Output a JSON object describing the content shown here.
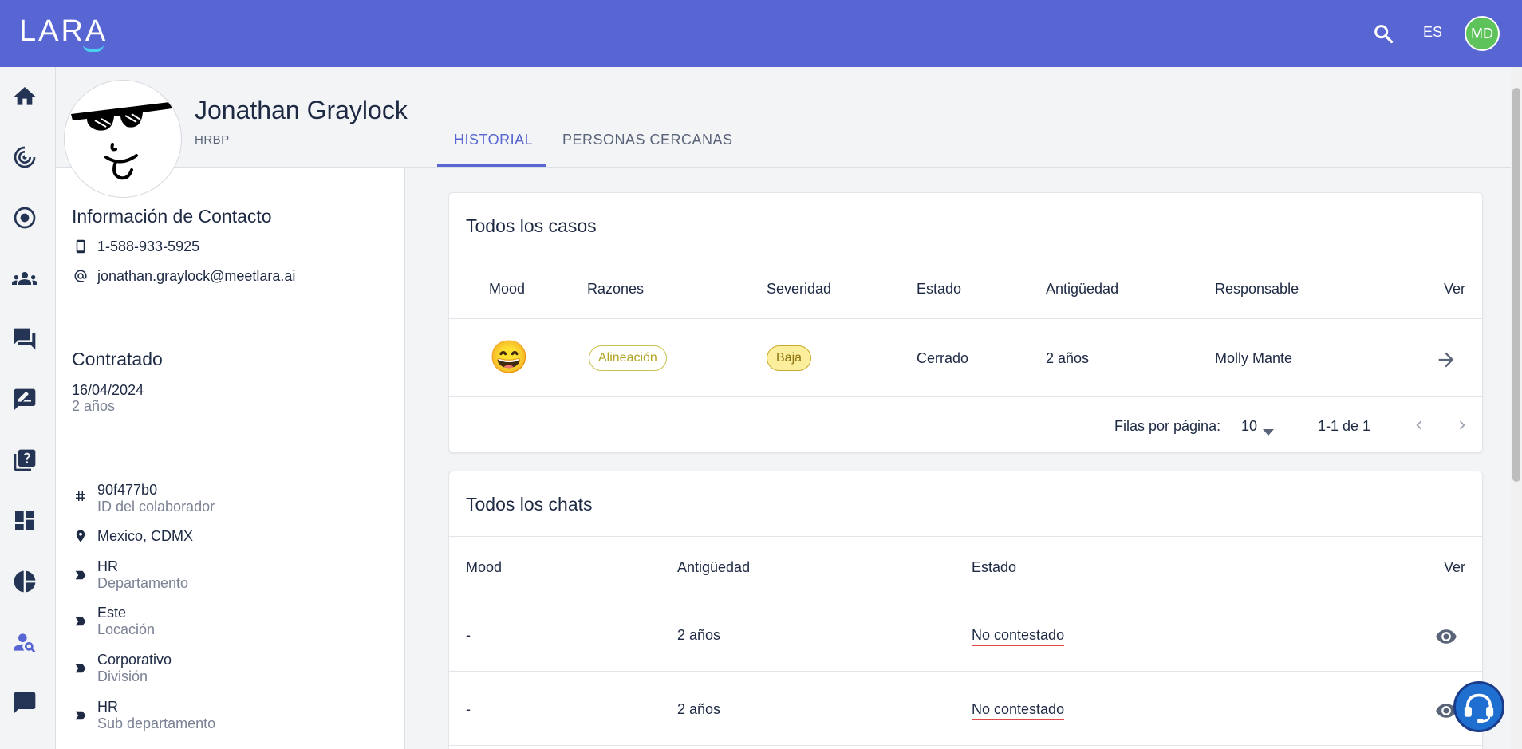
{
  "app": {
    "logo": "LARA",
    "lang": "ES",
    "user_initials": "MD",
    "brand_color": "#5766d3",
    "avatar_color": "#5ec35a"
  },
  "sidebar": {
    "items": [
      {
        "icon": "home-icon"
      },
      {
        "icon": "radar-icon"
      },
      {
        "icon": "target-icon"
      },
      {
        "icon": "groups-icon"
      },
      {
        "icon": "chat-bubbles-icon"
      },
      {
        "icon": "feedback-icon"
      },
      {
        "icon": "quiz-icon"
      },
      {
        "icon": "dashboard-icon"
      },
      {
        "icon": "pie-chart-icon"
      },
      {
        "icon": "person-search-icon"
      },
      {
        "icon": "chat-icon"
      }
    ]
  },
  "profile": {
    "name": "Jonathan Graylock",
    "role": "HRBP"
  },
  "tabs": {
    "historial": "HISTORIAL",
    "personas": "PERSONAS CERCANAS"
  },
  "contact": {
    "title": "Información de Contacto",
    "phone": "1-588-933-5925",
    "email": "jonathan.graylock@meetlara.ai"
  },
  "hired": {
    "title": "Contratado",
    "date": "16/04/2024",
    "tenure": "2 años"
  },
  "details": {
    "id_value": "90f477b0",
    "id_label": "ID del colaborador",
    "location": "Mexico, CDMX",
    "dept_value": "HR",
    "dept_label": "Departamento",
    "loc_value": "Este",
    "loc_label": "Locación",
    "div_value": "Corporativo",
    "div_label": "División",
    "subdept_value": "HR",
    "subdept_label": "Sub departamento"
  },
  "cases": {
    "title": "Todos los casos",
    "headers": {
      "mood": "Mood",
      "razones": "Razones",
      "severidad": "Severidad",
      "estado": "Estado",
      "antiguedad": "Antigüedad",
      "responsable": "Responsable",
      "ver": "Ver"
    },
    "row": {
      "mood_emoji": "😄",
      "razon": "Alineación",
      "severidad": "Baja",
      "estado": "Cerrado",
      "antiguedad": "2 años",
      "responsable": "Molly Mante"
    },
    "pagination": {
      "rows_label": "Filas por página:",
      "rows_value": "10",
      "range": "1-1 de 1"
    }
  },
  "chats": {
    "title": "Todos los chats",
    "headers": {
      "mood": "Mood",
      "antiguedad": "Antigüedad",
      "estado": "Estado",
      "ver": "Ver"
    },
    "rows": [
      {
        "mood": "-",
        "antiguedad": "2 años",
        "estado": "No contestado"
      },
      {
        "mood": "-",
        "antiguedad": "2 años",
        "estado": "No contestado"
      }
    ]
  }
}
